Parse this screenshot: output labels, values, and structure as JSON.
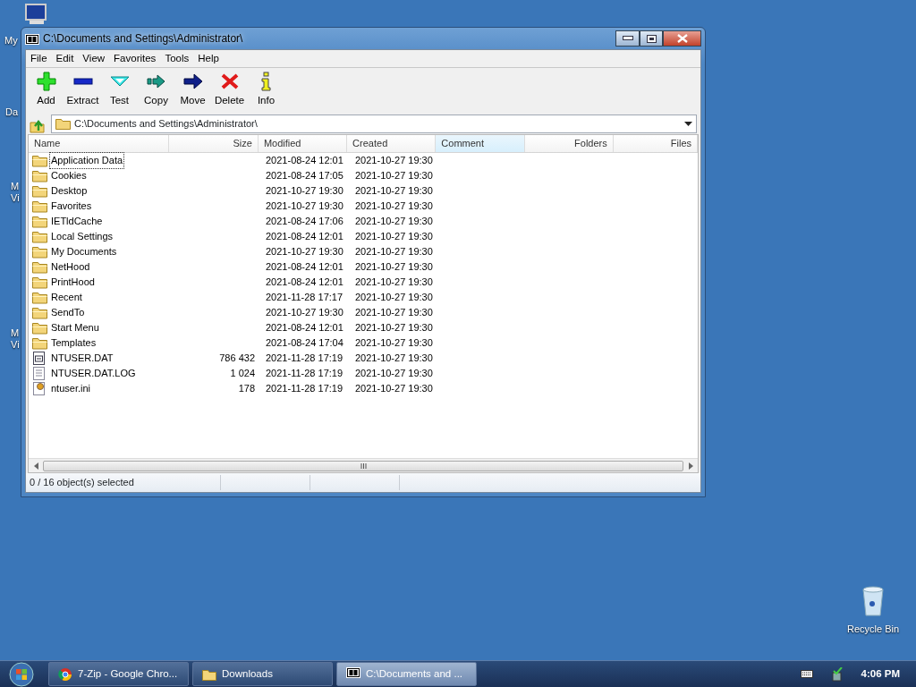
{
  "desktop_icons": [
    {
      "label": "My",
      "kind": "computer"
    },
    {
      "label": "Da",
      "kind": "blank"
    },
    {
      "label": "M Vi",
      "kind": "blank"
    },
    {
      "label": "M Vi",
      "kind": "blank"
    },
    {
      "label": "Recycle Bin",
      "kind": "bin"
    }
  ],
  "window": {
    "title": "C:\\Documents and Settings\\Administrator\\"
  },
  "menu": [
    "File",
    "Edit",
    "View",
    "Favorites",
    "Tools",
    "Help"
  ],
  "toolbar": [
    {
      "label": "Add",
      "kind": "add"
    },
    {
      "label": "Extract",
      "kind": "extract"
    },
    {
      "label": "Test",
      "kind": "test"
    },
    {
      "label": "Copy",
      "kind": "copy"
    },
    {
      "label": "Move",
      "kind": "move"
    },
    {
      "label": "Delete",
      "kind": "delete"
    },
    {
      "label": "Info",
      "kind": "info"
    }
  ],
  "address": {
    "path": "C:\\Documents and Settings\\Administrator\\"
  },
  "table": {
    "columns": [
      {
        "label": "Name",
        "selected": false
      },
      {
        "label": "Size",
        "selected": false
      },
      {
        "label": "Modified",
        "selected": false
      },
      {
        "label": "Created",
        "selected": false
      },
      {
        "label": "Comment",
        "selected": true
      },
      {
        "label": "Folders",
        "selected": false
      },
      {
        "label": "Files",
        "selected": false
      }
    ],
    "rows": [
      {
        "name": "Application Data",
        "kind": "folder",
        "size": "",
        "modified": "2021-08-24 12:01",
        "created": "2021-10-27 19:30",
        "focused": true
      },
      {
        "name": "Cookies",
        "kind": "folder",
        "size": "",
        "modified": "2021-08-24 17:05",
        "created": "2021-10-27 19:30",
        "focused": false
      },
      {
        "name": "Desktop",
        "kind": "folder",
        "size": "",
        "modified": "2021-10-27 19:30",
        "created": "2021-10-27 19:30",
        "focused": false
      },
      {
        "name": "Favorites",
        "kind": "folder",
        "size": "",
        "modified": "2021-10-27 19:30",
        "created": "2021-10-27 19:30",
        "focused": false
      },
      {
        "name": "IETldCache",
        "kind": "folder",
        "size": "",
        "modified": "2021-08-24 17:06",
        "created": "2021-10-27 19:30",
        "focused": false
      },
      {
        "name": "Local Settings",
        "kind": "folder",
        "size": "",
        "modified": "2021-08-24 12:01",
        "created": "2021-10-27 19:30",
        "focused": false
      },
      {
        "name": "My Documents",
        "kind": "folder",
        "size": "",
        "modified": "2021-10-27 19:30",
        "created": "2021-10-27 19:30",
        "focused": false
      },
      {
        "name": "NetHood",
        "kind": "folder",
        "size": "",
        "modified": "2021-08-24 12:01",
        "created": "2021-10-27 19:30",
        "focused": false
      },
      {
        "name": "PrintHood",
        "kind": "folder",
        "size": "",
        "modified": "2021-08-24 12:01",
        "created": "2021-10-27 19:30",
        "focused": false
      },
      {
        "name": "Recent",
        "kind": "folder",
        "size": "",
        "modified": "2021-11-28 17:17",
        "created": "2021-10-27 19:30",
        "focused": false
      },
      {
        "name": "SendTo",
        "kind": "folder",
        "size": "",
        "modified": "2021-10-27 19:30",
        "created": "2021-10-27 19:30",
        "focused": false
      },
      {
        "name": "Start Menu",
        "kind": "folder",
        "size": "",
        "modified": "2021-08-24 12:01",
        "created": "2021-10-27 19:30",
        "focused": false
      },
      {
        "name": "Templates",
        "kind": "folder",
        "size": "",
        "modified": "2021-08-24 17:04",
        "created": "2021-10-27 19:30",
        "focused": false
      },
      {
        "name": "NTUSER.DAT",
        "kind": "dat",
        "size": "786 432",
        "modified": "2021-11-28 17:19",
        "created": "2021-10-27 19:30",
        "focused": false
      },
      {
        "name": "NTUSER.DAT.LOG",
        "kind": "log",
        "size": "1 024",
        "modified": "2021-11-28 17:19",
        "created": "2021-10-27 19:30",
        "focused": false
      },
      {
        "name": "ntuser.ini",
        "kind": "ini",
        "size": "178",
        "modified": "2021-11-28 17:19",
        "created": "2021-10-27 19:30",
        "focused": false
      }
    ]
  },
  "status_bar": "0 / 16 object(s) selected",
  "taskbar": {
    "buttons": [
      {
        "label": "7-Zip - Google Chro...",
        "kind": "browser",
        "selected": false
      },
      {
        "label": "Downloads",
        "kind": "folder",
        "selected": false
      },
      {
        "label": "C:\\Documents and ...",
        "kind": "sevenzip",
        "selected": true
      }
    ],
    "clock": "4:06 PM"
  }
}
